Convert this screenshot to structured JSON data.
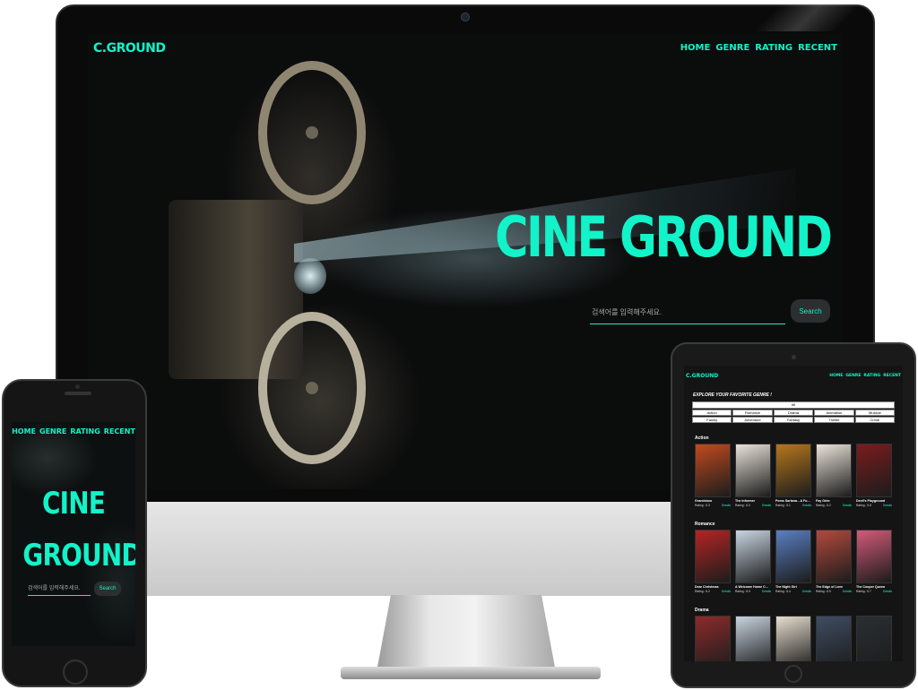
{
  "desktop": {
    "logo": "C.GROUND",
    "nav": [
      "HOME",
      "GENRE",
      "RATING",
      "RECENT"
    ],
    "hero_title": "CINE GROUND",
    "search": {
      "placeholder": "검색어를 입력해주세요.",
      "button": "Search"
    }
  },
  "mobile": {
    "nav": [
      "HOME",
      "GENRE",
      "RATING",
      "RECENT"
    ],
    "hero_title_line1": "CINE",
    "hero_title_line2": "GROUND",
    "search": {
      "placeholder": "검색어를 입력해주세요.",
      "button": "Search"
    }
  },
  "tablet": {
    "logo": "C.GROUND",
    "nav": [
      "HOME",
      "GENRE",
      "RATING",
      "RECENT"
    ],
    "genre_heading": "EXPLORE YOUR FAVORITE GENRE !",
    "genre_all": "All",
    "genres": [
      "Action",
      "Romance",
      "Drama",
      "Animation",
      "Musical",
      "Family",
      "Adventure",
      "Fantasy",
      "Thriller",
      "Crime"
    ],
    "details_label": "Details",
    "sections": [
      {
        "label": "Action",
        "movies": [
          {
            "title": "Grandsboo",
            "rating": "Rating : 5.3",
            "color": "#c24a1e"
          },
          {
            "title": "The Informer",
            "rating": "Rating : 6.0",
            "color": "#e9e4da"
          },
          {
            "title": "Poms Sartana…A Fo…",
            "rating": "Rating : 5.1",
            "color": "#b6771d"
          },
          {
            "title": "Fay Grim",
            "rating": "Rating : 6.2",
            "color": "#eae3d9"
          },
          {
            "title": "Devil's Playground",
            "rating": "Rating : 5.8",
            "color": "#7a1c1c"
          }
        ]
      },
      {
        "label": "Romance",
        "movies": [
          {
            "title": "Dear Christmas",
            "rating": "Rating : 6.2",
            "color": "#b52424"
          },
          {
            "title": "A Welcome Home C…",
            "rating": "Rating : 6.9",
            "color": "#c9d6e3"
          },
          {
            "title": "The Night Girl",
            "rating": "Rating : 6.4",
            "color": "#5a7fc1"
          },
          {
            "title": "The Edge of Love",
            "rating": "Rating : 6.5",
            "color": "#b24a3d"
          },
          {
            "title": "The Cooper Queen",
            "rating": "Rating : 5.7",
            "color": "#d35a78"
          }
        ]
      },
      {
        "label": "Drama",
        "movies": [
          {
            "title": "",
            "rating": "",
            "color": "#8e2b2b"
          },
          {
            "title": "",
            "rating": "",
            "color": "#c8d4e0"
          },
          {
            "title": "",
            "rating": "",
            "color": "#e7dfcf"
          },
          {
            "title": "",
            "rating": "",
            "color": "#3f4d63"
          },
          {
            "title": "",
            "rating": "",
            "color": "#2a2f33"
          }
        ]
      }
    ]
  }
}
